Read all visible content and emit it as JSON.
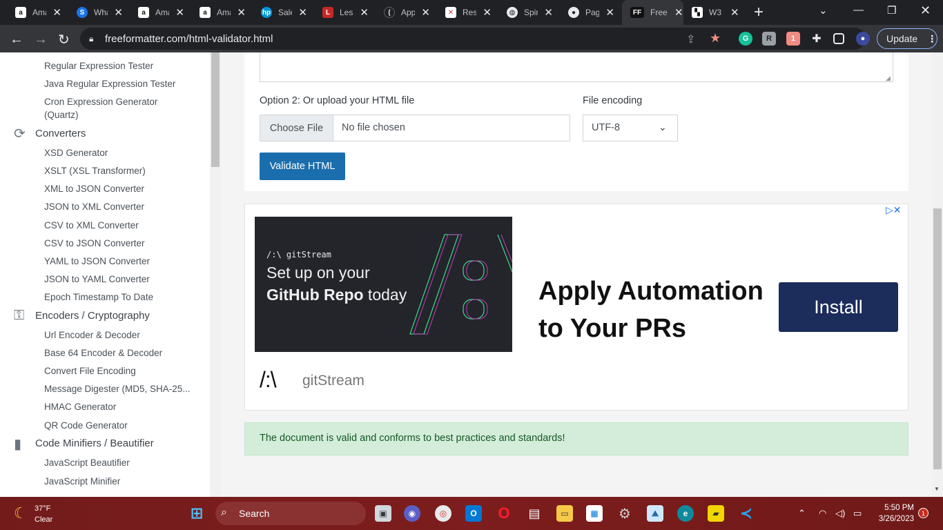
{
  "tabs": [
    {
      "title": "Ama",
      "icon": "amazon-icon"
    },
    {
      "title": "Wha",
      "icon": "s-icon"
    },
    {
      "title": "Ama",
      "icon": "amazon-icon"
    },
    {
      "title": "Ama",
      "icon": "amazon-icon"
    },
    {
      "title": "Sale",
      "icon": "hp-icon"
    },
    {
      "title": "Less",
      "icon": "lesson-icon"
    },
    {
      "title": "App",
      "icon": "app-icon"
    },
    {
      "title": "Resp",
      "icon": "resp-icon"
    },
    {
      "title": "Spir",
      "icon": "globe-icon"
    },
    {
      "title": "Pag",
      "icon": "github-icon"
    },
    {
      "title": "Free",
      "icon": "ff-icon"
    },
    {
      "title": "W3",
      "icon": "w3-icon"
    }
  ],
  "toolbar": {
    "url": "freeformatter.com/html-validator.html",
    "update_label": "Update"
  },
  "sidebar": {
    "items_top": [
      "Regular Expression Tester",
      "Java Regular Expression Tester",
      "Cron Expression Generator",
      "(Quartz)"
    ],
    "converters_title": "Converters",
    "converters": [
      "XSD Generator",
      "XSLT (XSL Transformer)",
      "XML to JSON Converter",
      "JSON to XML Converter",
      "CSV to XML Converter",
      "CSV to JSON Converter",
      "YAML to JSON Converter",
      "JSON to YAML Converter",
      "Epoch Timestamp To Date"
    ],
    "encoders_title": "Encoders / Cryptography",
    "encoders": [
      "Url Encoder & Decoder",
      "Base 64 Encoder & Decoder",
      "Convert File Encoding",
      "Message Digester (MD5, SHA-25...",
      "HMAC Generator",
      "QR Code Generator"
    ],
    "minifiers_title": "Code Minifiers / Beautifier",
    "minifiers": [
      "JavaScript Beautifier",
      "JavaScript Minifier"
    ]
  },
  "form": {
    "option2_label": "Option 2: Or upload your HTML file",
    "encoding_label": "File encoding",
    "choose_file": "Choose File",
    "no_file": "No file chosen",
    "encoding_value": "UTF-8",
    "validate_label": "Validate HTML"
  },
  "ad": {
    "brand_small": "/:\\ gitStream",
    "tagline1": "Set up on your",
    "tagline2_bold": "GitHub Repo",
    "tagline2_rest": " today",
    "headline1": "Apply Automation",
    "headline2": "to Your PRs",
    "install_label": "Install",
    "logo": "/:\\",
    "name": "gitStream"
  },
  "result": {
    "message": "The document is valid and conforms to best practices and standards!"
  },
  "taskbar": {
    "temp": "37°F",
    "weather": "Clear",
    "search_label": "Search",
    "time": "5:50 PM",
    "date": "3/26/2023",
    "notification_count": "1"
  }
}
